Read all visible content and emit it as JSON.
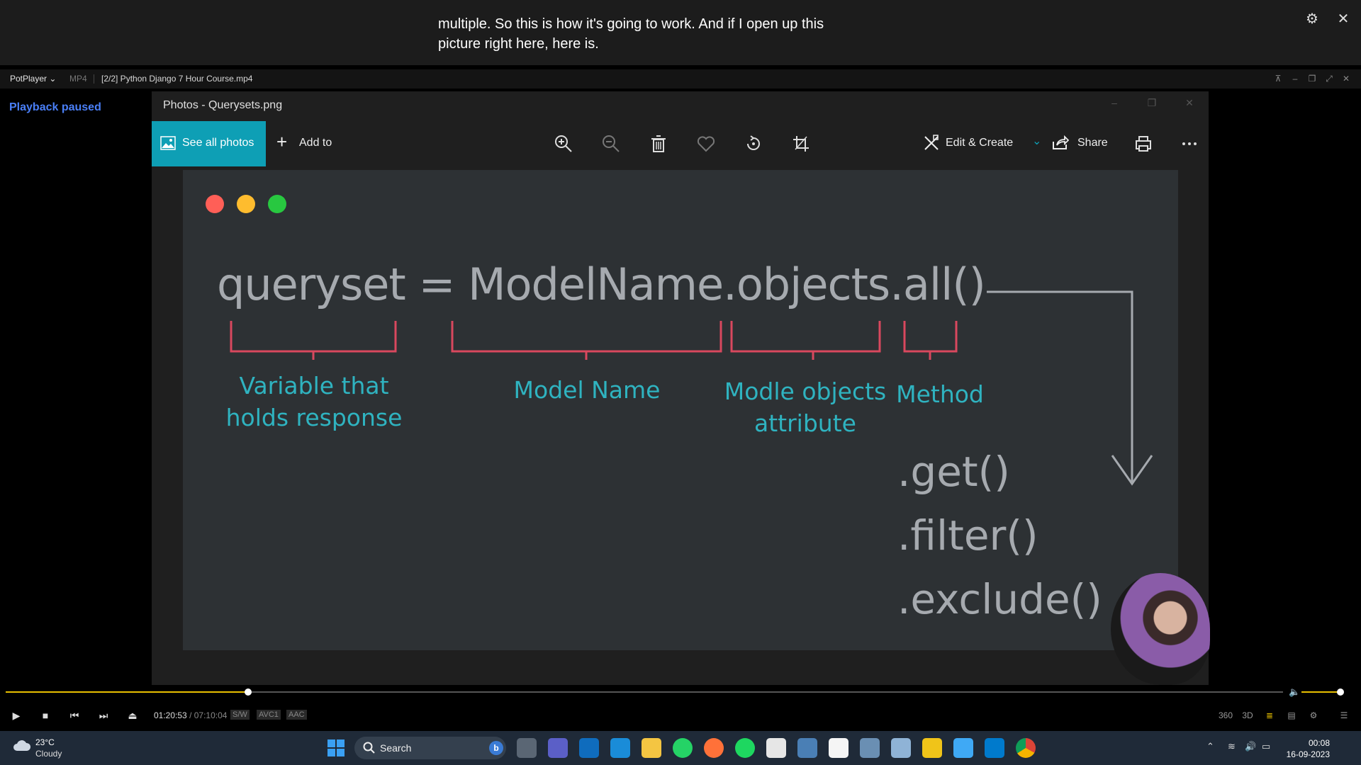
{
  "caption": {
    "line1": "multiple. So this is how it's going to work. And if I open up this",
    "line2": "picture right here, here is."
  },
  "player": {
    "app_name": "PotPlayer",
    "format": "MP4",
    "file": "[2/2] Python Django 7 Hour Course.mp4",
    "status": "Playback paused",
    "time_current": "01:20:53",
    "time_total": "07:10:04",
    "progress_fraction": 0.19,
    "volume_fraction": 0.95,
    "badges": [
      "S/W",
      "AVC1",
      "AAC"
    ]
  },
  "photos": {
    "title": "Photos - Querysets.png",
    "see_all": "See all photos",
    "add_to": "Add to",
    "edit_create": "Edit & Create",
    "share": "Share",
    "accent": "#0e9fb5"
  },
  "slide": {
    "code": "queryset = ModelName.objects.all()",
    "labels": {
      "variable_line1": "Variable that",
      "variable_line2": "holds response",
      "model_name": "Model Name",
      "objects_line1": "Modle objects",
      "objects_line2": "attribute",
      "method": "Method"
    },
    "methods": [
      ".get()",
      ".filter()",
      ".exclude()"
    ],
    "bracket_color": "#d9485e",
    "label_color": "#2fb3c0"
  },
  "taskbar": {
    "temperature": "23°C",
    "weather": "Cloudy",
    "search": "Search",
    "time": "00:08",
    "date": "16-09-2023"
  }
}
